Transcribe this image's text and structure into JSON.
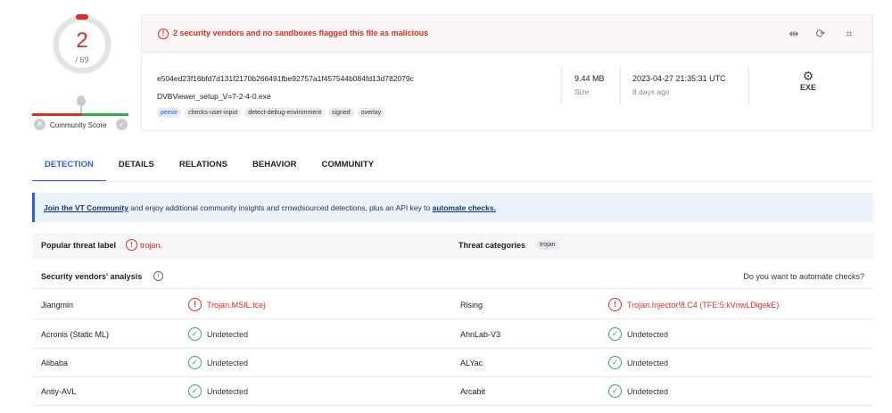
{
  "score": {
    "detections": "2",
    "total": "/ 69",
    "community_label": "Community Score"
  },
  "alert": {
    "text": "2 security vendors and no sandboxes flagged this file as malicious"
  },
  "file": {
    "hash": "e504ed23f16bfd7d131f2170b266491fbe92757a1f457544b084fd13d782079c",
    "name": "DVBViewer_setup_V=7-2-4-0.exe",
    "tags": [
      "peexe",
      "checks-user-input",
      "detect-debug-environment",
      "signed",
      "overlay"
    ],
    "size": "9.44 MB",
    "size_label": "Size",
    "date": "2023-04-27 21:35:31 UTC",
    "date_rel": "8 days ago",
    "type": "EXE"
  },
  "tabs": [
    "DETECTION",
    "DETAILS",
    "RELATIONS",
    "BEHAVIOR",
    "COMMUNITY"
  ],
  "banner": {
    "join": "Join the VT Community",
    "middle": " and enjoy additional community insights and crowdsourced detections, plus an API key to ",
    "automate": "automate checks."
  },
  "threat": {
    "popular_label": "Popular threat label",
    "popular_value": "trojan.",
    "categories_label": "Threat categories",
    "category": "trojan"
  },
  "vendors": {
    "title": "Security vendors' analysis",
    "automate_question": "Do you want to automate checks?",
    "rows": [
      {
        "left_name": "Jiangmin",
        "left_result": "Trojan.MSIL.tcej",
        "right_name": "Rising",
        "right_result": "Trojan.Injector!8.C4 (TFE:5:kVnwLDigekE)"
      },
      {
        "left_name": "Acronis (Static ML)",
        "left_result": "Undetected",
        "right_name": "AhnLab-V3",
        "right_result": "Undetected"
      },
      {
        "left_name": "Alibaba",
        "left_result": "Undetected",
        "right_name": "ALYac",
        "right_result": "Undetected"
      },
      {
        "left_name": "Antiy-AVL",
        "left_result": "Undetected",
        "right_name": "Arcabit",
        "right_result": "Undetected"
      }
    ]
  },
  "icons": {
    "alert": "alert-circle-icon",
    "compare": "compare-icon",
    "reanalyze": "refresh-icon",
    "graph": "graph-icon",
    "malicious": "alert-circle-icon",
    "undetected": "check-circle-icon"
  },
  "colors": {
    "malicious": "#d93025",
    "clean": "#34a853",
    "accent": "#2f61c8"
  }
}
